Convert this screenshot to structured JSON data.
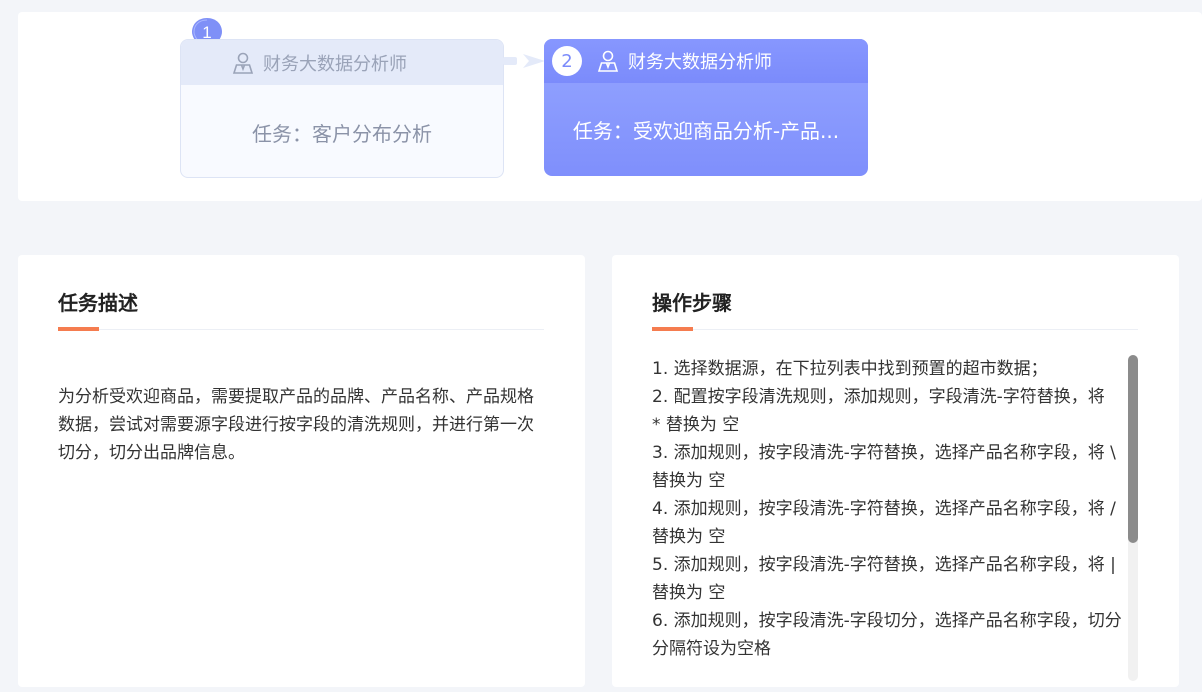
{
  "stepper": {
    "steps": [
      {
        "number": "1",
        "role": "财务大数据分析师",
        "task": "任务：客户分布分析",
        "state": "completed"
      },
      {
        "number": "2",
        "role": "财务大数据分析师",
        "task": "任务：受欢迎商品分析-产品...",
        "state": "active"
      }
    ]
  },
  "task_description": {
    "title": "任务描述",
    "text": "为分析受欢迎商品，需要提取产品的品牌、产品名称、产品规格数据，尝试对需要源字段进行按字段的清洗规则，并进行第一次切分，切分出品牌信息。"
  },
  "operation_steps": {
    "title": "操作步骤",
    "items": [
      "1. 选择数据源，在下拉列表中找到预置的超市数据；",
      "2. 配置按字段清洗规则，添加规则，字段清洗-字符替换，将",
      "* 替换为 空",
      "3. 添加规则，按字段清洗-字符替换，选择产品名称字段，将 \\ 替换为 空",
      "4. 添加规则，按字段清洗-字符替换，选择产品名称字段，将 / 替换为 空",
      "5. 添加规则，按字段清洗-字符替换，选择产品名称字段，将 | 替换为 空",
      "6. 添加规则，按字段清洗-字段切分，选择产品名称字段，切分分隔符设为空格"
    ]
  },
  "colors": {
    "accent_underline": "#f57c4f",
    "active_card": "#7f8ffc",
    "inactive_card": "#f8faff"
  }
}
